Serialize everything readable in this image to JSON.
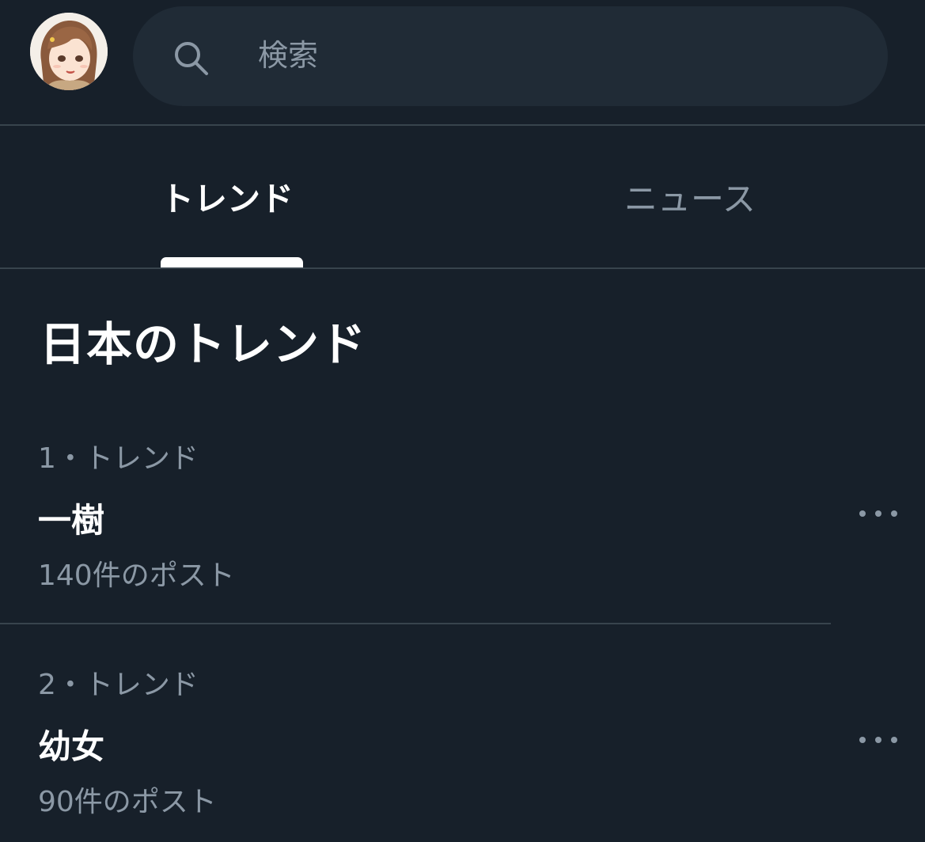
{
  "header": {
    "search_placeholder": "検索",
    "avatar_alt": "profile avatar",
    "search_icon": "search-icon"
  },
  "tabs": [
    {
      "label": "トレンド",
      "active": true
    },
    {
      "label": "ニュース",
      "active": false
    }
  ],
  "section": {
    "title": "日本のトレンド"
  },
  "trends": [
    {
      "meta": "1・トレンド",
      "name": "一樹",
      "count": "140件のポスト"
    },
    {
      "meta": "2・トレンド",
      "name": "幼女",
      "count": "90件のポスト"
    }
  ],
  "colors": {
    "background": "#17202a",
    "search_background": "#202b36",
    "divider": "#38444d",
    "muted_text": "#8b98a5",
    "primary_text": "#ffffff"
  },
  "icons": {
    "more": "more-horizontal-icon"
  }
}
